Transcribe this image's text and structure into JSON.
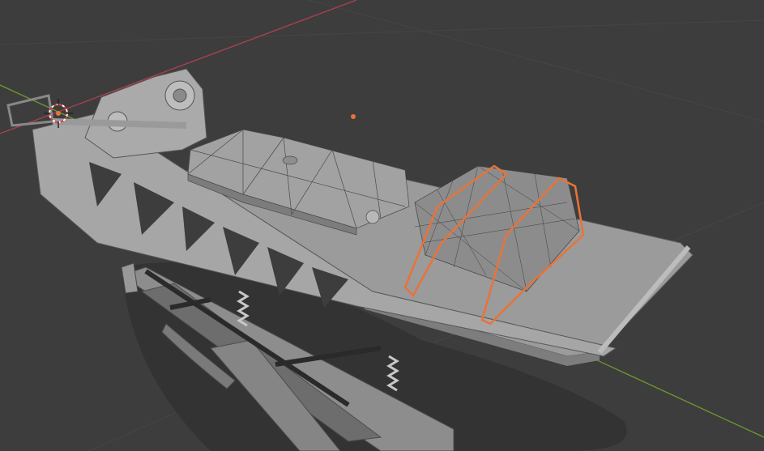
{
  "viewport": {
    "background": "#3d3d3d",
    "grid_color": "#474747",
    "x_axis_color": "#a8404f",
    "y_axis_color": "#6d9a2c"
  },
  "scene": {
    "mesh_color": "#9b9b9b",
    "mesh_dark": "#6f6f6f",
    "mesh_light": "#b5b5b5",
    "selection_outline": "#e8733a",
    "origin_point_color": "#e8733a",
    "cursor_icon": "3d-cursor-icon"
  }
}
